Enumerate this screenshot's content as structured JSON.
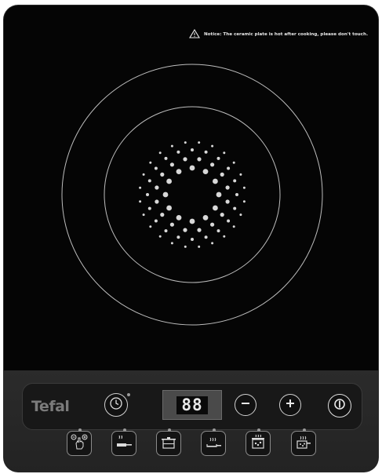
{
  "notice": {
    "icon": "warning-triangle-icon",
    "text": "Notice: The ceramic plate is hot after cooking, please don't touch."
  },
  "cooking_zone": {
    "outer_ring_icon": "outer-ring",
    "inner_ring_icon": "inner-ring"
  },
  "control_panel": {
    "brand": "Tefal",
    "display": "88",
    "timer_button": {
      "icon": "timer-icon"
    },
    "minus_button": {
      "icon": "minus-icon"
    },
    "plus_button": {
      "icon": "plus-icon"
    },
    "power_button": {
      "icon": "power-icon"
    },
    "function_buttons": [
      {
        "name": "keep-warm",
        "icon": "hand-touch-icon"
      },
      {
        "name": "fry",
        "icon": "frying-pan-icon"
      },
      {
        "name": "boil",
        "icon": "boiling-pot-icon"
      },
      {
        "name": "simmer",
        "icon": "steam-pan-icon"
      },
      {
        "name": "soup",
        "icon": "soup-pot-icon"
      },
      {
        "name": "stew",
        "icon": "stew-pot-icon"
      }
    ]
  }
}
